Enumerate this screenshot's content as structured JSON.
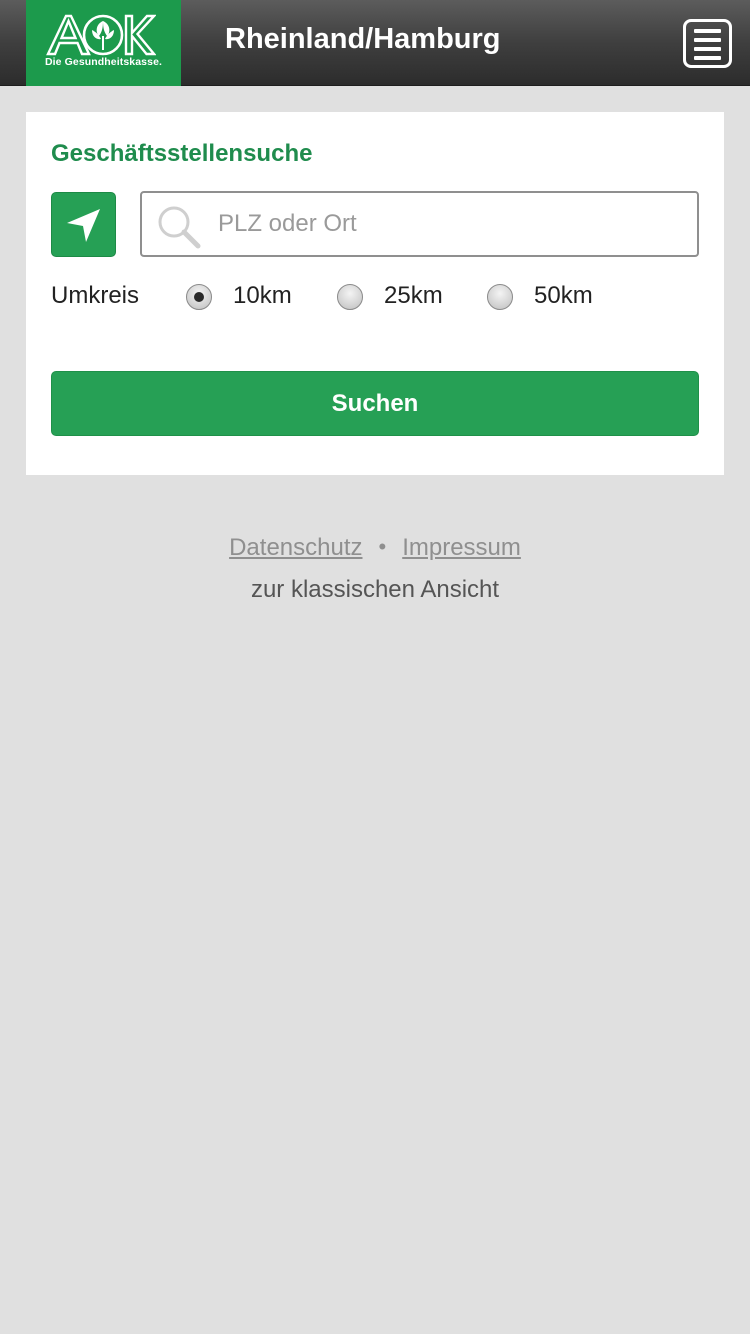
{
  "header": {
    "logo_text": "AOK",
    "logo_tagline": "Die Gesundheitskasse.",
    "title": "Rheinland/Hamburg",
    "menu_icon": "hamburger-menu-icon",
    "background_color": "#3f3f3f",
    "logo_color": "#1c9a4c"
  },
  "search": {
    "title": "Geschäftsstellensuche",
    "locate_icon": "location-arrow-icon",
    "field_icon": "search-icon",
    "placeholder": "PLZ oder Ort",
    "value": "",
    "radius_label": "Umkreis",
    "radius_options": [
      {
        "label": "10km",
        "selected": true
      },
      {
        "label": "25km",
        "selected": false
      },
      {
        "label": "50km",
        "selected": false
      }
    ],
    "submit_label": "Suchen",
    "accent_color": "#26a055",
    "title_color": "#1f8c4d"
  },
  "footer": {
    "privacy_link": "Datenschutz",
    "separator": "•",
    "imprint_link": "Impressum",
    "classic_view_link": "zur klassischen Ansicht"
  }
}
